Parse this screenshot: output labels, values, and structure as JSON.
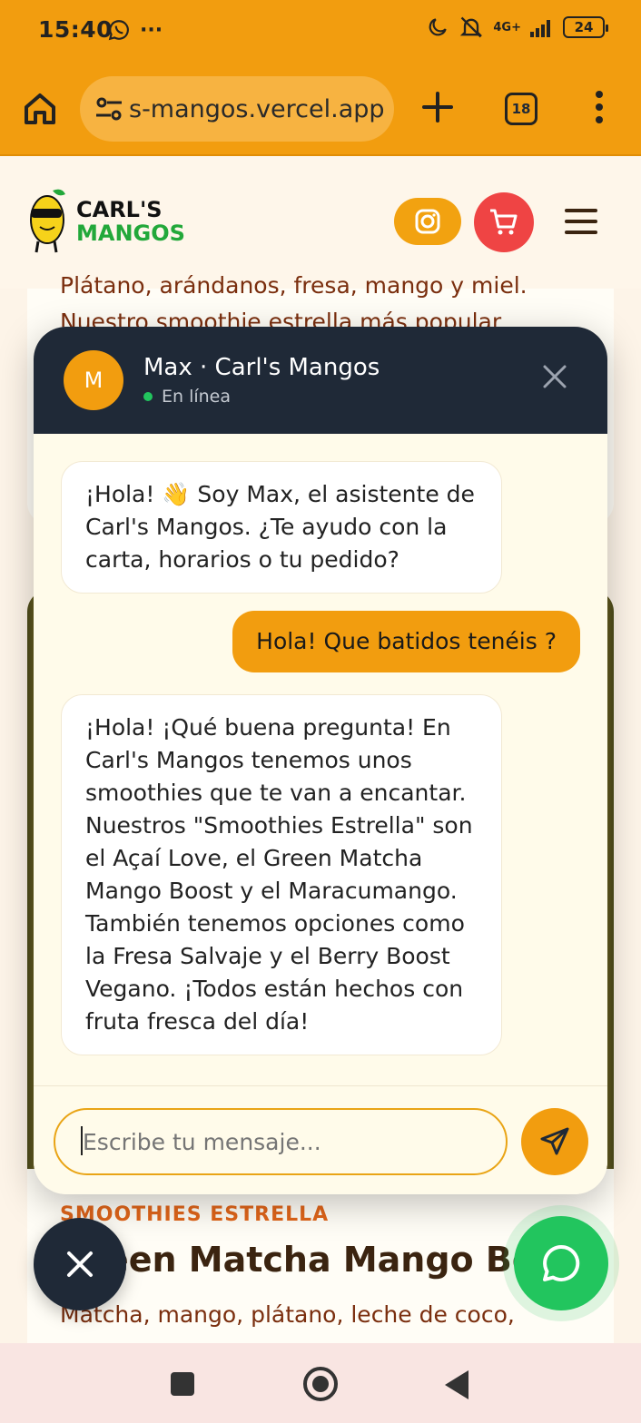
{
  "status_bar": {
    "time": "15:40",
    "battery": "24",
    "network": "4G+"
  },
  "browser": {
    "url": "s-mangos.vercel.app",
    "tab_count": "18"
  },
  "site": {
    "logo_line1": "CARL'S",
    "logo_line2": "MANGOS"
  },
  "background": {
    "text_line1": "Plátano, arándanos, fresa, mango y miel.",
    "text_line2": "Nuestro smoothie estrella más popular",
    "kicker": "SMOOTHIES ESTRELLA",
    "heading": "Green Matcha Mango Boost",
    "description": "Matcha, mango, plátano, leche de coco,"
  },
  "chat": {
    "avatar_initial": "M",
    "agent_name": "Max · Carl's Mangos",
    "status": "En línea",
    "messages": [
      {
        "from": "bot",
        "text": "¡Hola! 👋 Soy Max, el asistente de Carl's Mangos. ¿Te ayudo con la carta, horarios o tu pedido?"
      },
      {
        "from": "user",
        "text": "Hola! Que batidos tenéis ?"
      },
      {
        "from": "bot",
        "text": "¡Hola! ¡Qué buena pregunta! En Carl's Mangos tenemos unos smoothies que te van a encantar. Nuestros \"Smoothies Estrella\" son el Açaí Love, el Green Matcha Mango Boost y el Maracumango. También tenemos opciones como la Fresa Salvaje y el Berry Boost Vegano. ¡Todos están hechos con fruta fresca del día!"
      }
    ],
    "input_placeholder": "Escribe tu mensaje..."
  },
  "colors": {
    "brand_orange": "#f29d0f",
    "header_dark": "#1f2937",
    "whatsapp_green": "#22c55e",
    "cart_red": "#ef4444"
  }
}
